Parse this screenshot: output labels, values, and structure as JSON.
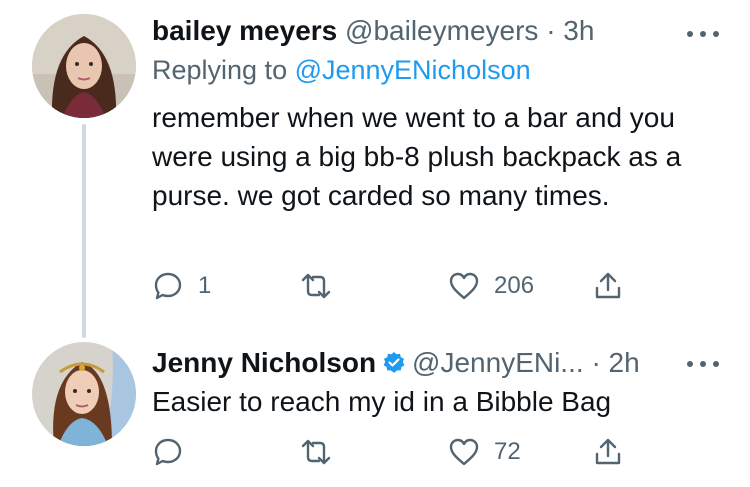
{
  "tweets": [
    {
      "name": "bailey meyers",
      "handle": "@baileymeyers",
      "separator": "·",
      "time": "3h",
      "replying_prefix": "Replying to ",
      "replying_to": "@JennyENicholson",
      "text": "remember when we went to a bar and you were using a big bb-8 plush backpack as a purse. we got carded so many times.",
      "reply_count": "1",
      "retweet_count": "",
      "like_count": "206",
      "verified": false
    },
    {
      "name": "Jenny Nicholson",
      "handle": "@JennyENi...",
      "separator": "·",
      "time": "2h",
      "text": "Easier to reach my id in a Bibble Bag",
      "reply_count": "",
      "retweet_count": "",
      "like_count": "72",
      "verified": true
    }
  ],
  "colors": {
    "text": "#0f1419",
    "secondary": "#536471",
    "link": "#1d9bf0",
    "thread_line": "#cfd9de"
  },
  "icons": [
    "more-icon",
    "reply-icon",
    "retweet-icon",
    "like-icon",
    "share-icon",
    "verified-badge-icon"
  ]
}
